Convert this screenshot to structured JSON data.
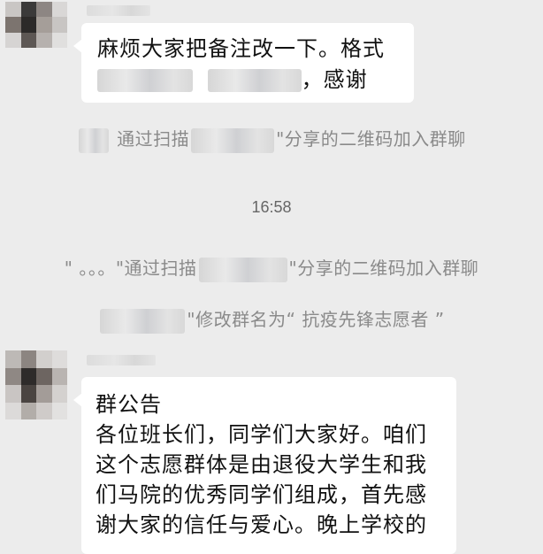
{
  "chat": {
    "message1": {
      "line1": "麻烦大家把备注改一下。格式",
      "line2_suffix": "，感谢"
    },
    "system1": {
      "prefix": "通过扫描",
      "suffix": "\"分享的二维码加入群聊"
    },
    "timestamp": "16:58",
    "system2": {
      "prefix": "\" 。。。\"通过扫描",
      "suffix": "\"分享的二维码加入群聊"
    },
    "system3": {
      "suffix": "\"修改群名为“ 抗疫先锋志愿者 ”"
    },
    "announcement": {
      "title": "群公告",
      "lines": [
        "各位班长们，同学们大家好。咱们",
        "这个志愿群体是由退役大学生和我",
        "们马院的优秀同学们组成，首先感",
        "谢大家的信任与爱心。晚上学校的"
      ]
    }
  },
  "colors": {
    "background": "#ececec",
    "bubble": "#ffffff",
    "system_text": "#8a8a8a"
  }
}
